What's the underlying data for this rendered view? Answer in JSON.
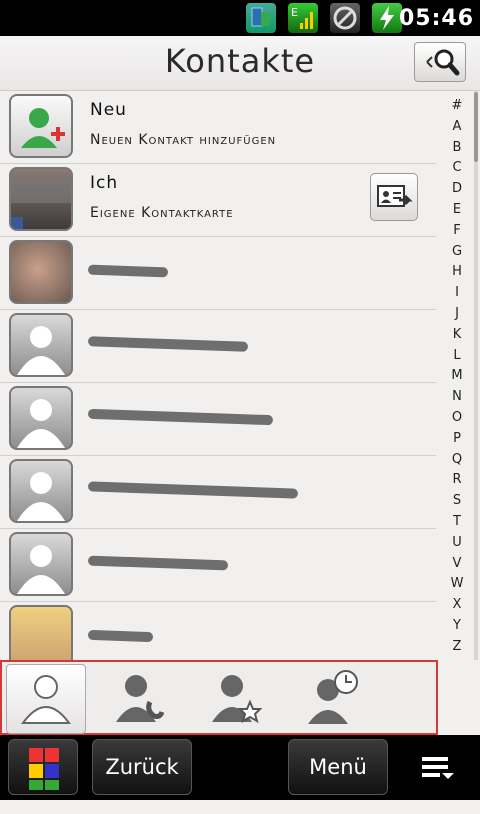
{
  "status_bar": {
    "time": "05:46",
    "icons": [
      "sim-toolkit-icon",
      "signal-icon",
      "sync-icon",
      "battery-charging-icon"
    ],
    "network_type": "E"
  },
  "header": {
    "title": "Kontakte",
    "search_icon": "search-icon"
  },
  "contacts": [
    {
      "name": "Neu",
      "subtitle": "Neuen Kontakt hinzufügen",
      "avatar": "add-contact-icon"
    },
    {
      "name": "Ich",
      "subtitle": "Eigene Kontaktkarte",
      "avatar": "photo",
      "action_icon": "contact-card-send-icon"
    },
    {
      "name": "",
      "avatar": "photo"
    },
    {
      "name": "",
      "avatar": "default-silhouette"
    },
    {
      "name": "",
      "avatar": "default-silhouette"
    },
    {
      "name": "",
      "avatar": "default-silhouette"
    },
    {
      "name": "",
      "avatar": "default-silhouette"
    },
    {
      "name": "",
      "avatar": "photo"
    }
  ],
  "alphabet": [
    "#",
    "A",
    "B",
    "C",
    "D",
    "E",
    "F",
    "G",
    "H",
    "I",
    "J",
    "K",
    "L",
    "M",
    "N",
    "O",
    "P",
    "Q",
    "R",
    "S",
    "T",
    "U",
    "V",
    "W",
    "X",
    "Y",
    "Z"
  ],
  "tabs": [
    {
      "icon": "contacts-tab-icon",
      "selected": true
    },
    {
      "icon": "phone-tab-icon",
      "selected": false
    },
    {
      "icon": "favorites-tab-icon",
      "selected": false
    },
    {
      "icon": "history-tab-icon",
      "selected": false
    }
  ],
  "bottom_bar": {
    "back_label": "Zurück",
    "menu_label": "Menü"
  },
  "colors": {
    "highlight_border": "#d23a3a",
    "background": "#f2f0ef"
  }
}
